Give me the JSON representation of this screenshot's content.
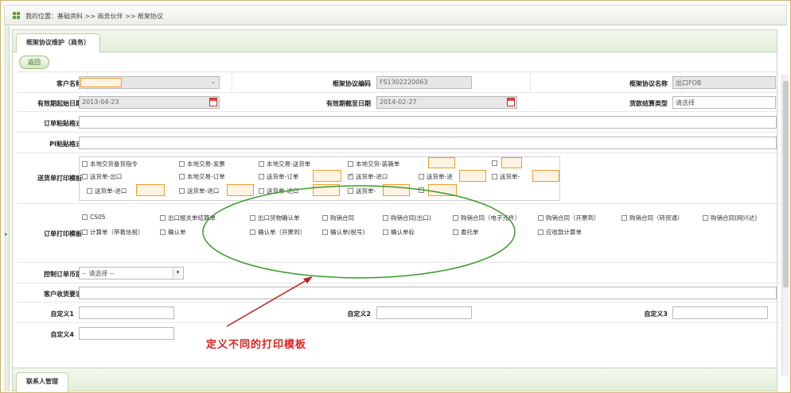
{
  "breadcrumb": {
    "text": "我的位置：基础资料 >> 商务伙伴 >> 框架协议"
  },
  "tabs": {
    "main": "框架协议维护（商务）",
    "contacts": "联系人管理"
  },
  "buttons": {
    "back": "返回"
  },
  "form": {
    "customer_name": {
      "label": "客户名称",
      "value": ""
    },
    "framework_code": {
      "label": "框架协议编码",
      "value": "FS1302220063"
    },
    "framework_name": {
      "label": "框架协议名称",
      "value": "出口FOB"
    },
    "start_date": {
      "label": "有效期起始日期",
      "value": "2013-04-23"
    },
    "end_date": {
      "label": "有效期截至日期",
      "value": "2014-02-27"
    },
    "settlement_type": {
      "label": "货款结算类型",
      "placeholder": "请选择"
    },
    "order_paste_format": {
      "label": "订单粘贴格式"
    },
    "pi_paste_format": {
      "label": "PI粘贴格式"
    },
    "delivery_print_template": {
      "label": "送货单打印模板",
      "options": [
        "本地交货备货指令",
        "本地交易-发票",
        "本地交易-送货单",
        "本地交货-装箱单",
        "送货单-出口",
        "本地交易-订单",
        "送货单-订单",
        "送货单-进口",
        "送货单-进",
        "送货单-进口",
        "送货单-进口",
        "送货单-进口",
        "送货单-"
      ]
    },
    "order_print_template": {
      "label": "订单打印模板",
      "options": [
        "CS05",
        "出口报关单结算单",
        "出口货物确认单",
        "购销合同",
        "购销合同(出口)",
        "购销合同（电子元件）",
        "购销合同（开票到）",
        "购销合同（转贸通）",
        "购销合同(网兴达)",
        "计算单（带着信税）",
        "确认单",
        "确认单（开票到）",
        "确认单(税号)",
        "确认单标",
        "委托单",
        "应收款计算单"
      ]
    },
    "control_order_type": {
      "label": "控制订单币别",
      "value": "-- 请选择 --"
    },
    "customer_requirements": {
      "label": "客户收货要求"
    },
    "custom1": {
      "label": "自定义1"
    },
    "custom2": {
      "label": "自定义2"
    },
    "custom3": {
      "label": "自定义3"
    },
    "custom4": {
      "label": "自定义4"
    }
  },
  "annotation": {
    "text": "定义不同的打印模板",
    "color": "#e0201c"
  }
}
